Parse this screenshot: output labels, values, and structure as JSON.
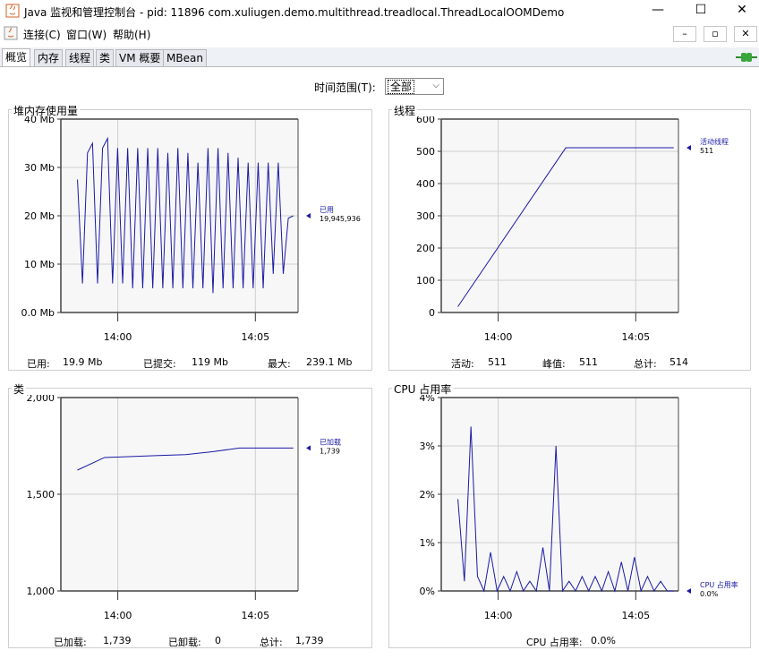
{
  "window": {
    "title": "Java 监视和管理控制台 - pid: 11896 com.xuliugen.demo.multithread.treadlocal.ThreadLocalOOMDemo",
    "minimize": "—",
    "maximize": "☐",
    "close": "✕"
  },
  "menubar": {
    "items": [
      "连接(C)",
      "窗口(W)",
      "帮助(H)"
    ],
    "inner_min": "–",
    "inner_restore": "▫",
    "inner_close": "✕"
  },
  "tabs": [
    "概览",
    "内存",
    "线程",
    "类",
    "VM 概要",
    "MBean"
  ],
  "active_tab": "概览",
  "time_range": {
    "label": "时间范围(T):",
    "value": "全部"
  },
  "colors": {
    "line": "#1a1aa6",
    "plot_bg": "#f7f7f7",
    "grid": "#cfcfcf"
  },
  "panels": {
    "heap": {
      "title": "堆内存使用量",
      "legend_name": "已用",
      "legend_value": "19,945,936",
      "stats": [
        {
          "label": "已用:",
          "value": "19.9  Mb"
        },
        {
          "label": "已提交:",
          "value": "119  Mb"
        },
        {
          "label": "最大:",
          "value": "239.1  Mb"
        }
      ]
    },
    "threads": {
      "title": "线程",
      "legend_name": "活动线程",
      "legend_value": "511",
      "stats": [
        {
          "label": "活动:",
          "value": "511"
        },
        {
          "label": "峰值:",
          "value": "511"
        },
        {
          "label": "总计:",
          "value": "514"
        }
      ]
    },
    "classes": {
      "title": "类",
      "legend_name": "已加载",
      "legend_value": "1,739",
      "stats": [
        {
          "label": "已加载:",
          "value": "1,739"
        },
        {
          "label": "已卸载:",
          "value": "0"
        },
        {
          "label": "总计:",
          "value": "1,739"
        }
      ]
    },
    "cpu": {
      "title": "CPU 占用率",
      "legend_name": "CPU 占用率",
      "legend_value": "0.0%",
      "stats": [
        {
          "label": "CPU 占用率:",
          "value": "0.0%"
        }
      ]
    }
  },
  "chart_data": [
    {
      "type": "line",
      "title": "堆内存使用量",
      "x_ticks": [
        "14:00",
        "14:05"
      ],
      "y_ticks": [
        "0.0 Mb",
        "10 Mb",
        "20 Mb",
        "30 Mb",
        "40 Mb"
      ],
      "ylim": [
        0,
        40
      ],
      "grid": true,
      "series": [
        {
          "name": "已用",
          "values": [
            27.5,
            6,
            33,
            35,
            6,
            34,
            36,
            6,
            34,
            6,
            34,
            5,
            34,
            5,
            34,
            5,
            34,
            5,
            33,
            5,
            34,
            5,
            33,
            5,
            31,
            5,
            34,
            4,
            34,
            5,
            33,
            5,
            32,
            5,
            31,
            5,
            31,
            5,
            31,
            8,
            31,
            8,
            19.5,
            20
          ]
        }
      ]
    },
    {
      "type": "line",
      "title": "线程",
      "x_ticks": [
        "14:00",
        "14:05"
      ],
      "y_ticks": [
        "0",
        "100",
        "200",
        "300",
        "400",
        "500",
        "600"
      ],
      "ylim": [
        0,
        600
      ],
      "grid": true,
      "series": [
        {
          "name": "活动线程",
          "values": [
            18,
            511,
            511
          ]
        }
      ]
    },
    {
      "type": "line",
      "title": "类",
      "x_ticks": [
        "14:00",
        "14:05"
      ],
      "y_ticks": [
        "1,000",
        "1,500",
        "2,000"
      ],
      "ylim": [
        1000,
        2000
      ],
      "grid": true,
      "series": [
        {
          "name": "已加载",
          "values": [
            1625,
            1690,
            1695,
            1700,
            1705,
            1720,
            1739,
            1739,
            1739
          ]
        }
      ]
    },
    {
      "type": "line",
      "title": "CPU 占用率",
      "x_ticks": [
        "14:00",
        "14:05"
      ],
      "y_ticks": [
        "0%",
        "1%",
        "2%",
        "3%",
        "4%"
      ],
      "ylim": [
        0,
        4
      ],
      "grid": true,
      "series": [
        {
          "name": "CPU 占用率",
          "values": [
            1.9,
            0.2,
            3.4,
            0.3,
            0,
            0.8,
            0,
            0.3,
            0,
            0.4,
            0,
            0.2,
            0,
            0.9,
            0,
            3.0,
            0,
            0.2,
            0,
            0.3,
            0,
            0.3,
            0,
            0.4,
            0,
            0.6,
            0,
            0.7,
            0,
            0.3,
            0,
            0.2,
            0,
            0
          ]
        }
      ]
    }
  ]
}
